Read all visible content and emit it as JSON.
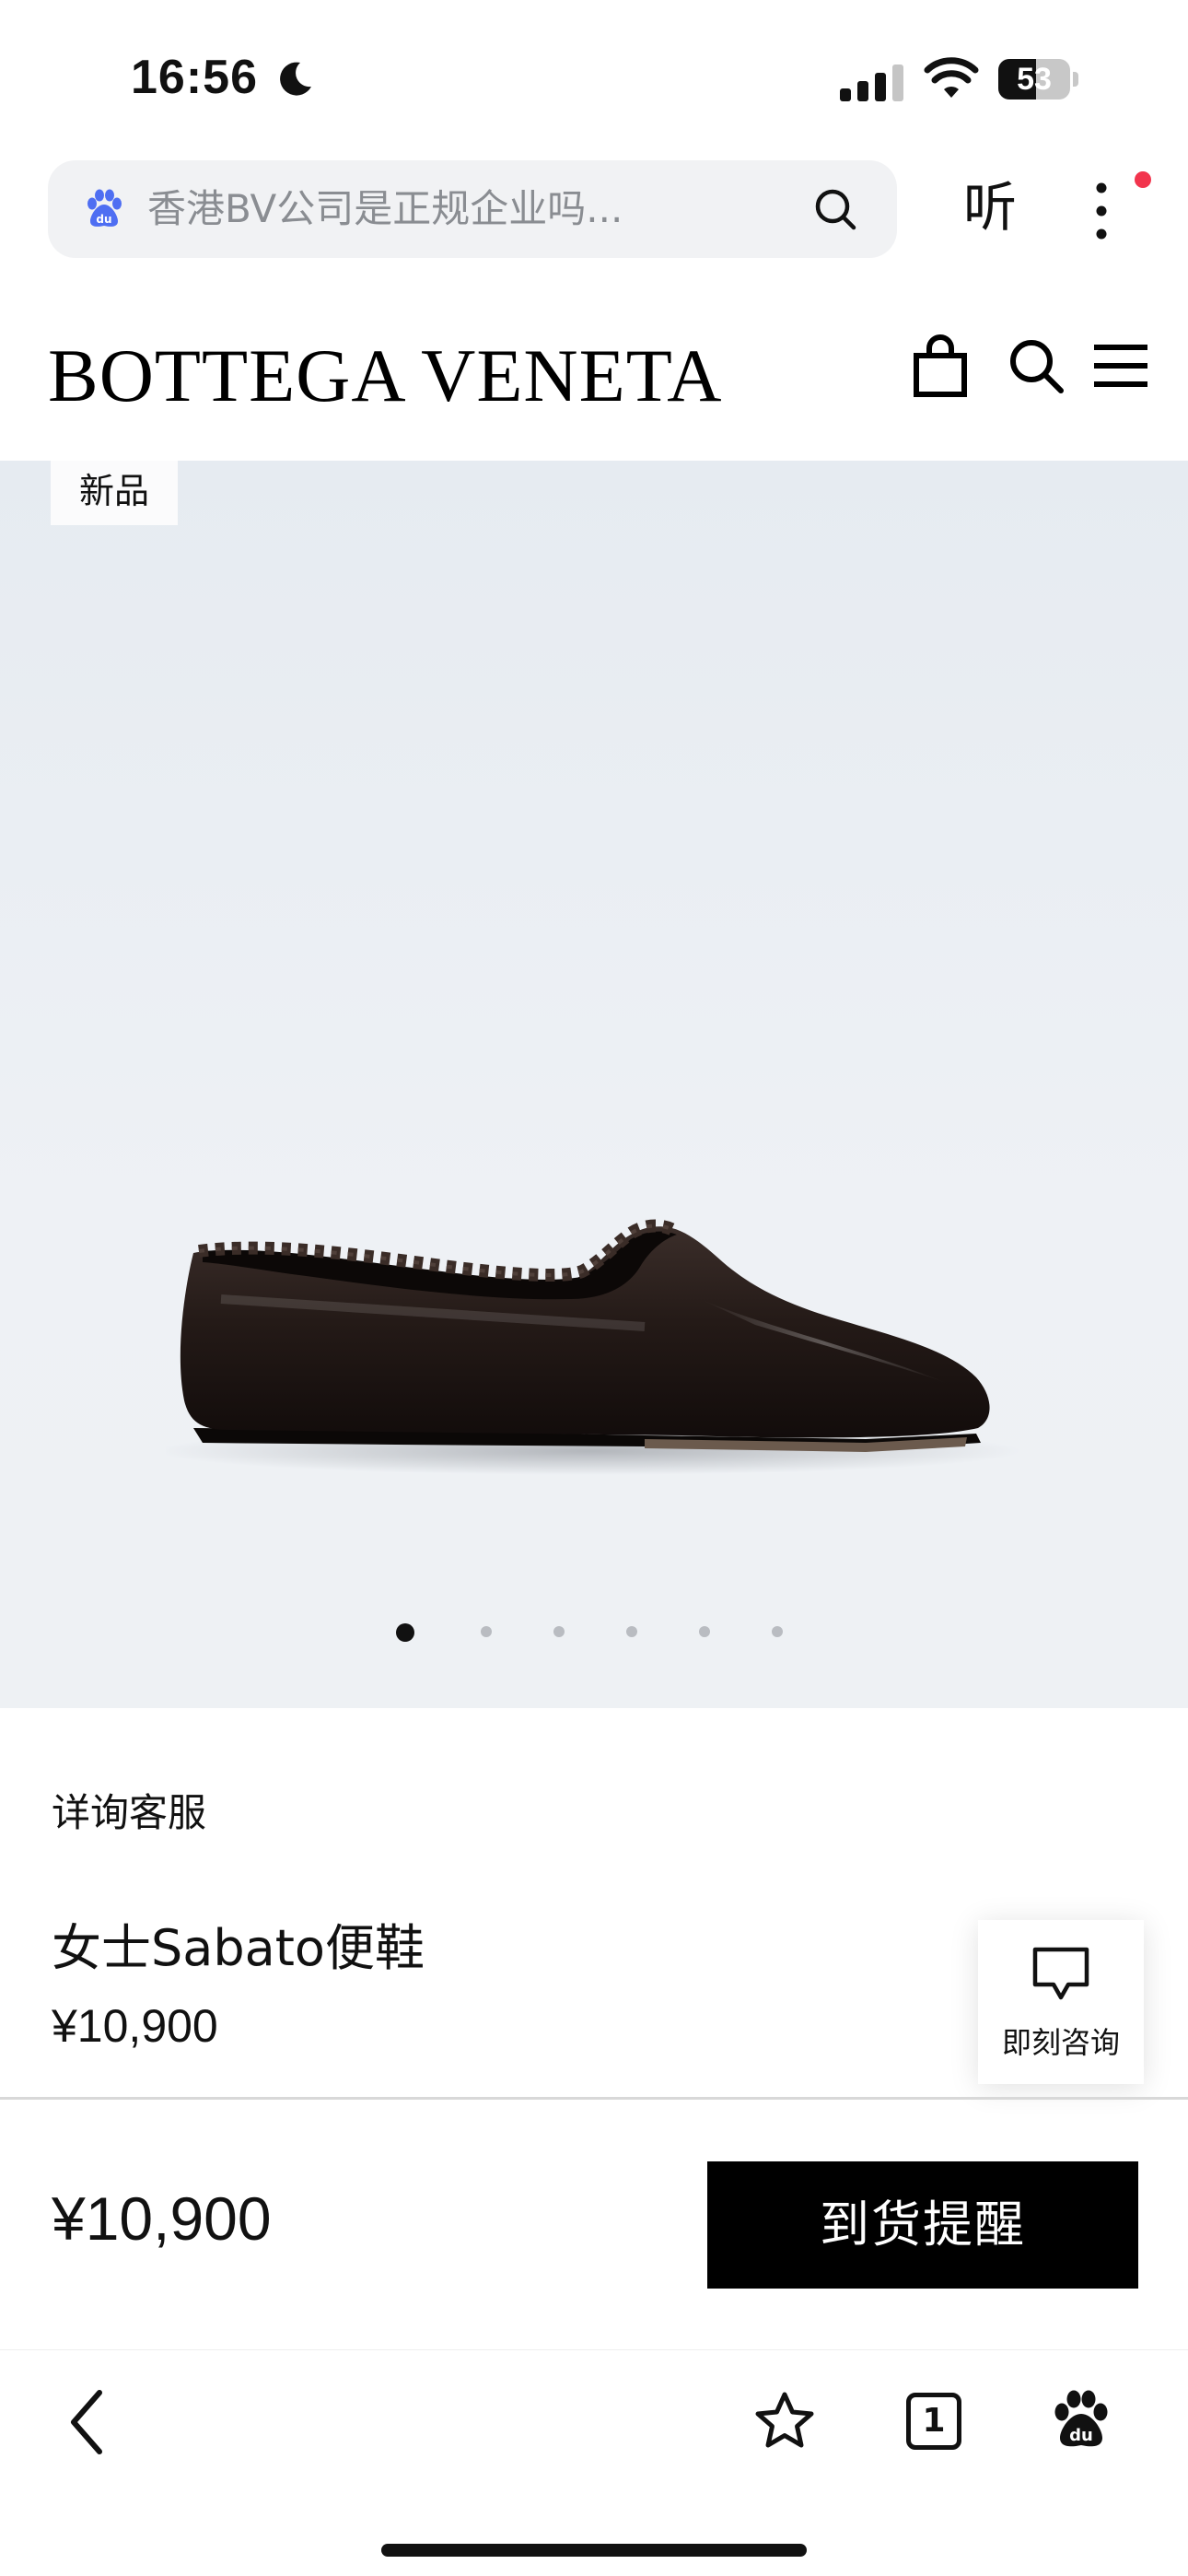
{
  "status_bar": {
    "time": "16:56",
    "battery_level": "53",
    "battery_fraction": 0.53
  },
  "browser": {
    "search_text": "香港BV公司是正规企业吗...",
    "listen_label": "听",
    "tab_count": "1"
  },
  "header": {
    "brand": "BOTTEGA VENETA"
  },
  "product": {
    "badge": "新品",
    "image_count": 6,
    "active_image": 1,
    "service_link": "详询客服",
    "name": "女士Sabato便鞋",
    "price": "¥10,900",
    "consult_label": "即刻咨询"
  },
  "sticky_bar": {
    "price": "¥10,900",
    "notify_label": "到货提醒"
  },
  "colors": {
    "accent": "#000000",
    "notify_dot": "#f2344d",
    "baidu_icon": "#4e6ef2"
  }
}
